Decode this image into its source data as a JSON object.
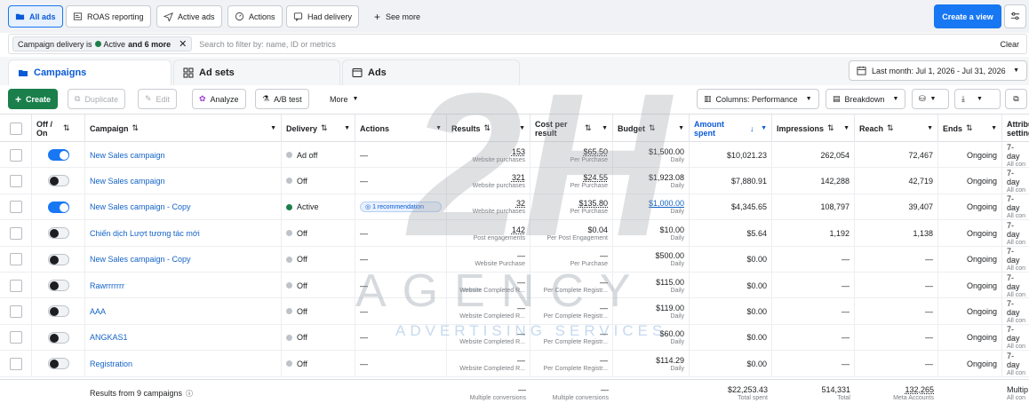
{
  "top_tabs": {
    "all_ads": "All ads",
    "roas": "ROAS reporting",
    "active_ads": "Active ads",
    "actions": "Actions",
    "had_delivery": "Had delivery",
    "see_more": "See more",
    "create_view": "Create a view"
  },
  "filter": {
    "chip_prefix": "Campaign delivery is",
    "chip_active": "Active",
    "chip_more": "and 6 more",
    "placeholder": "Search to filter by: name, ID or metrics",
    "clear": "Clear"
  },
  "levels": {
    "campaigns": "Campaigns",
    "adsets": "Ad sets",
    "ads": "Ads",
    "date_range": "Last month: Jul 1, 2026 - Jul 31, 2026"
  },
  "toolbar": {
    "create": "Create",
    "duplicate": "Duplicate",
    "edit": "Edit",
    "analyze": "Analyze",
    "ab_test": "A/B test",
    "more": "More",
    "columns": "Columns: Performance",
    "breakdown": "Breakdown"
  },
  "headers": {
    "onoff": "Off / On",
    "campaign": "Campaign",
    "delivery": "Delivery",
    "actions": "Actions",
    "results": "Results",
    "cost_per_result": "Cost per result",
    "budget": "Budget",
    "amount_spent": "Amount spent",
    "impressions": "Impressions",
    "reach": "Reach",
    "ends": "Ends",
    "attribution": "Attribution setting"
  },
  "rows": [
    {
      "name": "New Sales campaign",
      "on": true,
      "delivery": "Ad off",
      "delivery_color": "#bec3c9",
      "actions": "—",
      "results": "153",
      "results_sub": "Website purchases",
      "cost": "$65.50",
      "cost_sub": "Per Purchase",
      "budget": "$1,500.00",
      "budget_sub": "Daily",
      "spent": "$10,021.23",
      "impressions": "262,054",
      "reach": "72,467",
      "ends": "Ongoing",
      "attr": "7-day",
      "attr_sub": "All con"
    },
    {
      "name": "New Sales campaign",
      "on": false,
      "delivery": "Off",
      "delivery_color": "#bec3c9",
      "actions": "—",
      "results": "321",
      "results_sub": "Website purchases",
      "cost": "$24.55",
      "cost_sub": "Per Purchase",
      "budget": "$1,923.08",
      "budget_sub": "Daily",
      "spent": "$7,880.91",
      "impressions": "142,288",
      "reach": "42,719",
      "ends": "Ongoing",
      "attr": "7-day",
      "attr_sub": "All con"
    },
    {
      "name": "New Sales campaign - Copy",
      "on": true,
      "delivery": "Active",
      "delivery_color": "#1a7f4b",
      "actions": "1 recommendation",
      "results": "32",
      "results_sub": "Website purchases",
      "cost": "$135.80",
      "cost_sub": "Per Purchase",
      "budget": "$1,000.00",
      "budget_sub": "Daily",
      "spent": "$4,345.65",
      "impressions": "108,797",
      "reach": "39,407",
      "ends": "Ongoing",
      "attr": "7-day",
      "attr_sub": "All con"
    },
    {
      "name": "Chiến dịch Lượt tương tác mới",
      "on": false,
      "delivery": "Off",
      "delivery_color": "#bec3c9",
      "actions": "—",
      "results": "142",
      "results_sub": "Post engagements",
      "cost": "$0.04",
      "cost_sub": "Per Post Engagement",
      "budget": "$10.00",
      "budget_sub": "Daily",
      "spent": "$5.64",
      "impressions": "1,192",
      "reach": "1,138",
      "ends": "Ongoing",
      "attr": "7-day",
      "attr_sub": "All con"
    },
    {
      "name": "New Sales campaign - Copy",
      "on": false,
      "delivery": "Off",
      "delivery_color": "#bec3c9",
      "actions": "—",
      "results": "—",
      "results_sub": "Website Purchase",
      "cost": "—",
      "cost_sub": "Per Purchase",
      "budget": "$500.00",
      "budget_sub": "Daily",
      "spent": "$0.00",
      "impressions": "—",
      "reach": "—",
      "ends": "Ongoing",
      "attr": "7-day",
      "attr_sub": "All con"
    },
    {
      "name": "Rawrrrrrrr",
      "on": false,
      "delivery": "Off",
      "delivery_color": "#bec3c9",
      "actions": "—",
      "results": "—",
      "results_sub": "Website Completed R...",
      "cost": "—",
      "cost_sub": "Per Complete Registr...",
      "budget": "$115.00",
      "budget_sub": "Daily",
      "spent": "$0.00",
      "impressions": "—",
      "reach": "—",
      "ends": "Ongoing",
      "attr": "7-day",
      "attr_sub": "All con"
    },
    {
      "name": "AAA",
      "on": false,
      "delivery": "Off",
      "delivery_color": "#bec3c9",
      "actions": "—",
      "results": "—",
      "results_sub": "Website Completed R...",
      "cost": "—",
      "cost_sub": "Per Complete Registr...",
      "budget": "$119.00",
      "budget_sub": "Daily",
      "spent": "$0.00",
      "impressions": "—",
      "reach": "—",
      "ends": "Ongoing",
      "attr": "7-day",
      "attr_sub": "All con"
    },
    {
      "name": "ANGKAS1",
      "on": false,
      "delivery": "Off",
      "delivery_color": "#bec3c9",
      "actions": "—",
      "results": "—",
      "results_sub": "Website Completed R...",
      "cost": "—",
      "cost_sub": "Per Complete Registr...",
      "budget": "$60.00",
      "budget_sub": "Daily",
      "spent": "$0.00",
      "impressions": "—",
      "reach": "—",
      "ends": "Ongoing",
      "attr": "7-day",
      "attr_sub": "All con"
    },
    {
      "name": "Registration",
      "on": false,
      "delivery": "Off",
      "delivery_color": "#bec3c9",
      "actions": "—",
      "results": "—",
      "results_sub": "Website Completed R...",
      "cost": "—",
      "cost_sub": "Per Complete Registr...",
      "budget": "$114.29",
      "budget_sub": "Daily",
      "spent": "$0.00",
      "impressions": "—",
      "reach": "—",
      "ends": "Ongoing",
      "attr": "7-day",
      "attr_sub": "All con"
    }
  ],
  "footer": {
    "label": "Results from 9 campaigns",
    "results": "—",
    "results_sub": "Multiple conversions",
    "cost": "—",
    "cost_sub": "Multiple conversions",
    "spent": "$22,253.43",
    "spent_sub": "Total spent",
    "impressions": "514,331",
    "impressions_sub": "Total",
    "reach": "132,265",
    "reach_sub": "Meta Accounts",
    "attr": "Multip",
    "attr_sub": "All con"
  },
  "watermark": {
    "mark": "2H",
    "agency": "AGENCY",
    "tagline": "ADVERTISING SERVICES"
  },
  "colors": {
    "brand_blue": "#1877f2",
    "create_green": "#1a7f4b",
    "active_dot": "#1a7f4b",
    "off_dot": "#bec3c9"
  }
}
